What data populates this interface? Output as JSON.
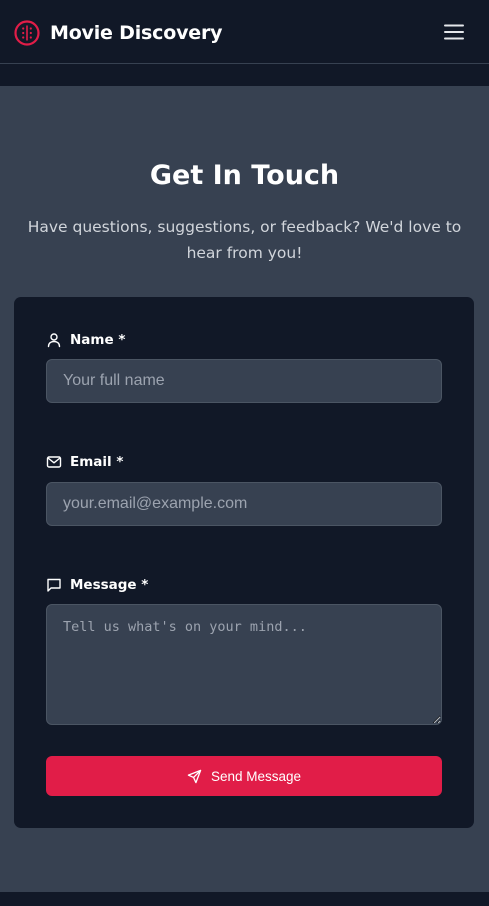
{
  "header": {
    "brand_title": "Movie Discovery",
    "brand_icon": "film-reel-icon",
    "menu_icon": "hamburger-menu-icon"
  },
  "contact": {
    "title": "Get In Touch",
    "subtitle": "Have questions, suggestions, or feedback? We'd love to hear from you!"
  },
  "form": {
    "name": {
      "label": "Name *",
      "icon": "user-icon",
      "value": "",
      "placeholder": "Your full name"
    },
    "email": {
      "label": "Email *",
      "icon": "mail-icon",
      "value": "",
      "placeholder": "your.email@example.com"
    },
    "message": {
      "label": "Message *",
      "icon": "message-square-icon",
      "value": "",
      "placeholder": "Tell us what's on your mind..."
    },
    "submit": {
      "label": "Send Message",
      "icon": "send-icon"
    }
  },
  "colors": {
    "header_bg": "#111827",
    "section_bg": "#374151",
    "card_bg": "#111827",
    "input_bg": "#374151",
    "accent": "#e11d48"
  }
}
